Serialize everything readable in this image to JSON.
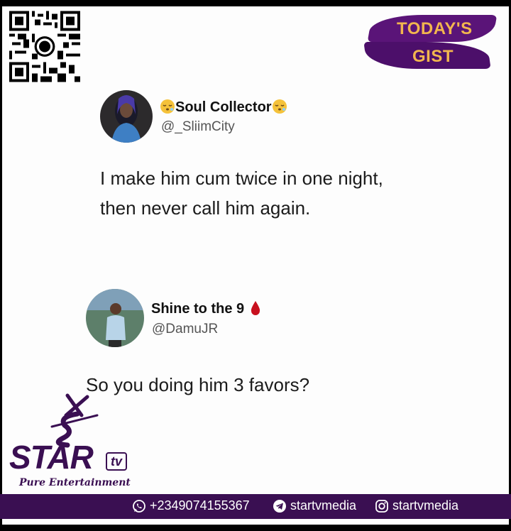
{
  "banner": {
    "line1": "TODAY'S",
    "line2": "GIST"
  },
  "tweets": [
    {
      "name": "Soul Collector",
      "handle": "@_SliimCity",
      "text_lines": [
        "I make him cum twice in one night,",
        "then never call him again."
      ],
      "emoji": "sleeping-face-icon"
    },
    {
      "name": "Shine to the 9",
      "handle": "@DamuJR",
      "text_lines": [
        "So you doing him 3 favors?"
      ],
      "emoji": "blood-drop-icon"
    }
  ],
  "brand": {
    "name": "STAR",
    "badge": "tv",
    "tagline": "Pure Entertainment"
  },
  "footer": {
    "phone": "+2349074155367",
    "telegram": "startvmedia",
    "instagram": "startvmedia"
  },
  "colors": {
    "brand_purple": "#3a0f52",
    "accent_gold": "#f2b64e",
    "drop_red": "#c8101e"
  }
}
